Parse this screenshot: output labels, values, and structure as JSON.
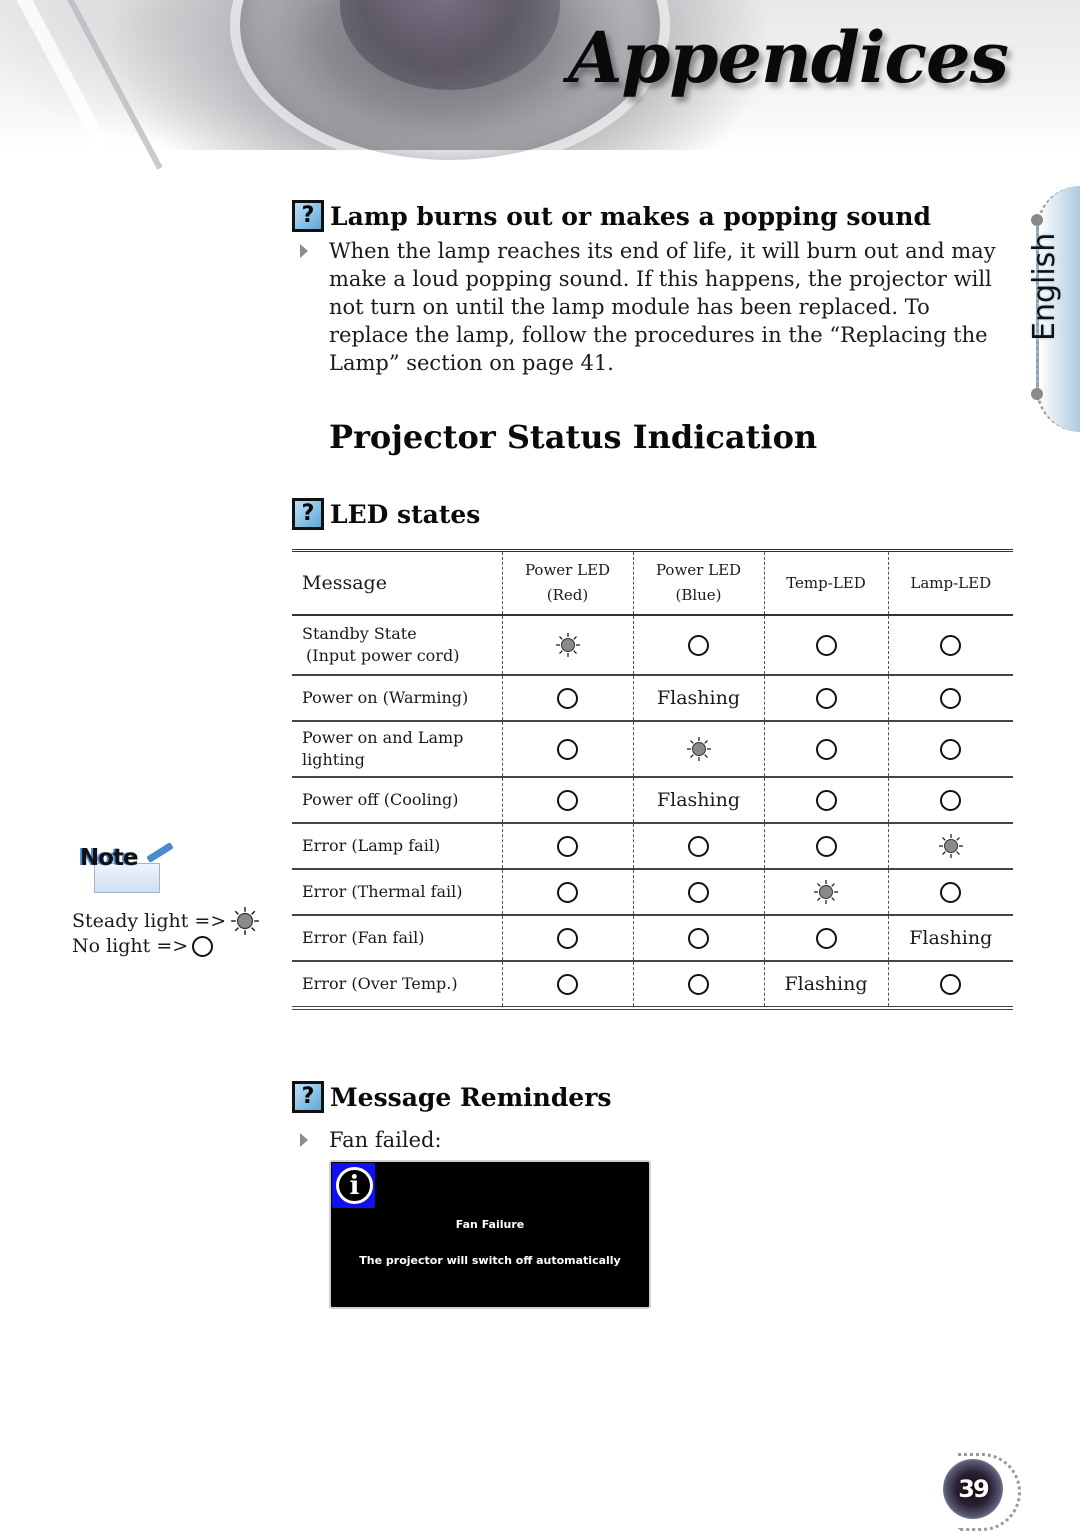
{
  "header": {
    "title": "Appendices"
  },
  "side_tab": {
    "language": "English"
  },
  "lamp_section": {
    "heading": "Lamp burns out or makes a popping sound",
    "paragraph": "When the lamp reaches its end of life, it will burn out and may make a loud popping sound.  If this happens, the projector will not turn on until the lamp module has been replaced. To replace the lamp, follow the procedures in the “Replacing the Lamp” section on page 41."
  },
  "status_section": {
    "title": "Projector Status Indication",
    "led_heading": "LED states",
    "table": {
      "headers": [
        {
          "line1": "Message",
          "line2": ""
        },
        {
          "line1": "Power LED",
          "line2": "(Red)"
        },
        {
          "line1": "Power LED",
          "line2": "(Blue)"
        },
        {
          "line1": "Temp-LED",
          "line2": ""
        },
        {
          "line1": "Lamp-LED",
          "line2": ""
        }
      ],
      "rows": [
        {
          "message_line1": "Standby State",
          "message_line2": "(Input power cord)",
          "states": [
            "on",
            "off",
            "off",
            "off"
          ]
        },
        {
          "message_line1": "Power on (Warming)",
          "message_line2": "",
          "states": [
            "off",
            "Flashing",
            "off",
            "off"
          ]
        },
        {
          "message_line1": "Power on and Lamp",
          "message_line2": "lighting",
          "states": [
            "off",
            "on",
            "off",
            "off"
          ]
        },
        {
          "message_line1": "Power off (Cooling)",
          "message_line2": "",
          "states": [
            "off",
            "Flashing",
            "off",
            "off"
          ]
        },
        {
          "message_line1": "Error (Lamp fail)",
          "message_line2": "",
          "states": [
            "off",
            "off",
            "off",
            "on"
          ]
        },
        {
          "message_line1": "Error (Thermal fail)",
          "message_line2": "",
          "states": [
            "off",
            "off",
            "on",
            "off"
          ]
        },
        {
          "message_line1": "Error (Fan fail)",
          "message_line2": "",
          "states": [
            "off",
            "off",
            "off",
            "Flashing"
          ]
        },
        {
          "message_line1": "Error (Over Temp.)",
          "message_line2": "",
          "states": [
            "off",
            "off",
            "Flashing",
            "off"
          ]
        }
      ]
    }
  },
  "note": {
    "label": "Note",
    "steady_light": "Steady light =>",
    "no_light": "No light =>"
  },
  "reminders_section": {
    "heading": "Message Reminders",
    "item": "Fan failed:",
    "osd": {
      "icon": "i",
      "title": "Fan Failure",
      "message": "The projector will switch off automatically"
    }
  },
  "footer": {
    "page_number": "39"
  },
  "colors": {
    "icon_blue": "#5fa7d8",
    "osd_icon_bg": "#1010f0",
    "led_on_fill": "#8a8a8a"
  }
}
